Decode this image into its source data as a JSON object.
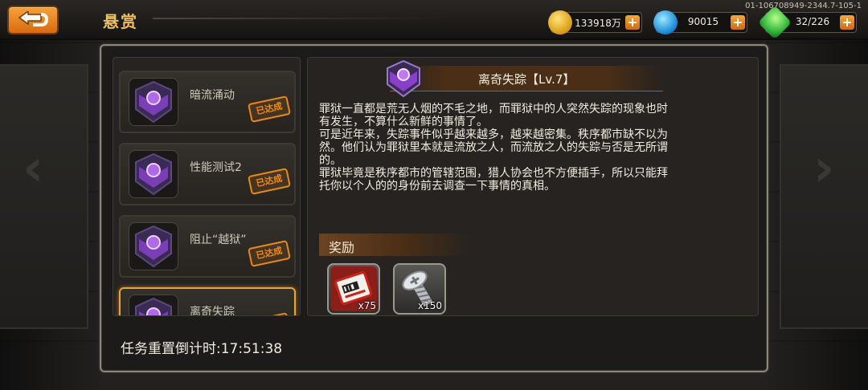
{
  "header": {
    "back_label": "back",
    "title": "悬赏",
    "server_id": "01-106708949-2344.7-105-1"
  },
  "resources": {
    "gold": {
      "icon": "gold-coin-icon",
      "value": "133918万"
    },
    "gem": {
      "icon": "blue-crystal-icon",
      "value": "90015"
    },
    "energy": {
      "icon": "green-energy-icon",
      "value": "32/226"
    }
  },
  "missions": [
    {
      "label": "暗流涌动",
      "status": "已达成",
      "selected": false
    },
    {
      "label": "性能测试2",
      "status": "已达成",
      "selected": false
    },
    {
      "label": "阻止“越狱”",
      "status": "已达成",
      "selected": false
    },
    {
      "label": "离奇失踪",
      "status": "",
      "selected": true
    }
  ],
  "detail": {
    "title": "离奇失踪【Lv.7】",
    "description": "罪狱一直都是荒无人烟的不毛之地，而罪狱中的人突然失踪的现象也时\n有发生，不算什么新鲜的事情了。\n 可是近年来，失踪事件似乎越来越多，越来越密集。秩序都市缺不以为\n然。他们认为罪狱里本就是流放之人，而流放之人的失踪与否是无所谓\n的。\n罪狱毕竟是秩序都市的管辖范围，猎人协会也不方便插手，所以只能拜\n托你以个人的的身份前去调查一下事情的真相。",
    "rewards_title": "奖励",
    "rewards": [
      {
        "icon": "ticket-icon",
        "qty": "x75"
      },
      {
        "icon": "screw-icon",
        "qty": "x150"
      }
    ]
  },
  "footer": {
    "countdown": "任务重置倒计时:17:51:38"
  },
  "colors": {
    "accent_orange": "#f0a23a",
    "stamp_orange": "#f08c18",
    "title_gold": "#f0c060",
    "medal_purple": "#8a3fc9"
  }
}
